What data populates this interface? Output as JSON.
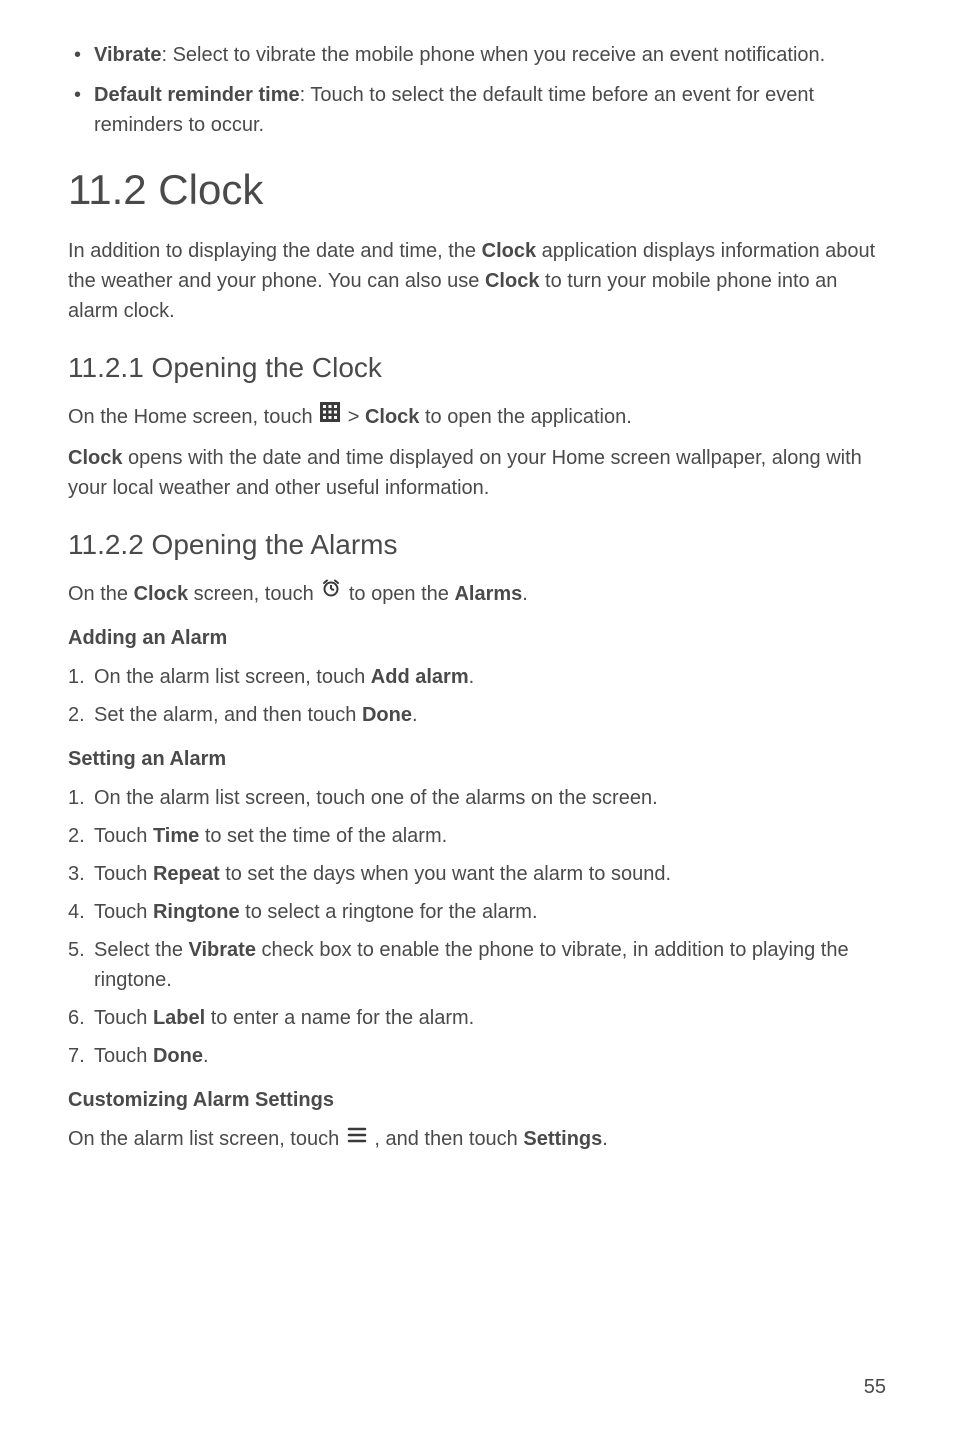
{
  "topBullets": [
    {
      "bold": "Vibrate",
      "text": ": Select to vibrate the mobile phone when you receive an event notification."
    },
    {
      "bold": "Default reminder time",
      "text": ": Touch to select the default time before an event for event reminders to occur."
    }
  ],
  "h1": "11.2  Clock",
  "introPart1": "In addition to displaying the date and time, the ",
  "introBold1": "Clock",
  "introPart2": " application displays information about the weather and your phone. You can also use ",
  "introBold2": "Clock",
  "introPart3": " to turn your mobile phone into an alarm clock.",
  "s1": {
    "heading": "11.2.1  Opening the Clock",
    "p1a": "On the Home screen, touch ",
    "p1b": " > ",
    "p1bold": "Clock",
    "p1c": " to open the application.",
    "p2a": "Clock",
    "p2b": " opens with the date and time displayed on your Home screen wallpaper, along with your local weather and other useful information."
  },
  "s2": {
    "heading": "11.2.2  Opening the Alarms",
    "p1a": "On the ",
    "p1bold1": "Clock",
    "p1b": " screen, touch ",
    "p1c": " to open the ",
    "p1bold2": "Alarms",
    "p1d": "."
  },
  "addAlarm": {
    "heading": "Adding an Alarm",
    "step1a": "On the alarm list screen, touch ",
    "step1bold": "Add alarm",
    "step1b": ".",
    "step2a": "Set the alarm, and then touch ",
    "step2bold": "Done",
    "step2b": "."
  },
  "setAlarm": {
    "heading": "Setting an Alarm",
    "step1": "On the alarm list screen, touch one of the alarms on the screen.",
    "step2a": "Touch ",
    "step2bold": "Time",
    "step2b": " to set the time of the alarm.",
    "step3a": "Touch ",
    "step3bold": "Repeat",
    "step3b": " to set the days when you want the alarm to sound.",
    "step4a": "Touch ",
    "step4bold": "Ringtone",
    "step4b": " to select a ringtone for the alarm.",
    "step5a": "Select the ",
    "step5bold": "Vibrate",
    "step5b": " check box to enable the phone to vibrate, in addition to playing the ringtone.",
    "step6a": "Touch ",
    "step6bold": "Label",
    "step6b": " to enter a name for the alarm.",
    "step7a": "Touch ",
    "step7bold": "Done",
    "step7b": "."
  },
  "customize": {
    "heading": "Customizing Alarm Settings",
    "p1a": "On the alarm list screen, touch ",
    "p1b": " , and then touch ",
    "p1bold": "Settings",
    "p1c": "."
  },
  "pageNumber": "55"
}
